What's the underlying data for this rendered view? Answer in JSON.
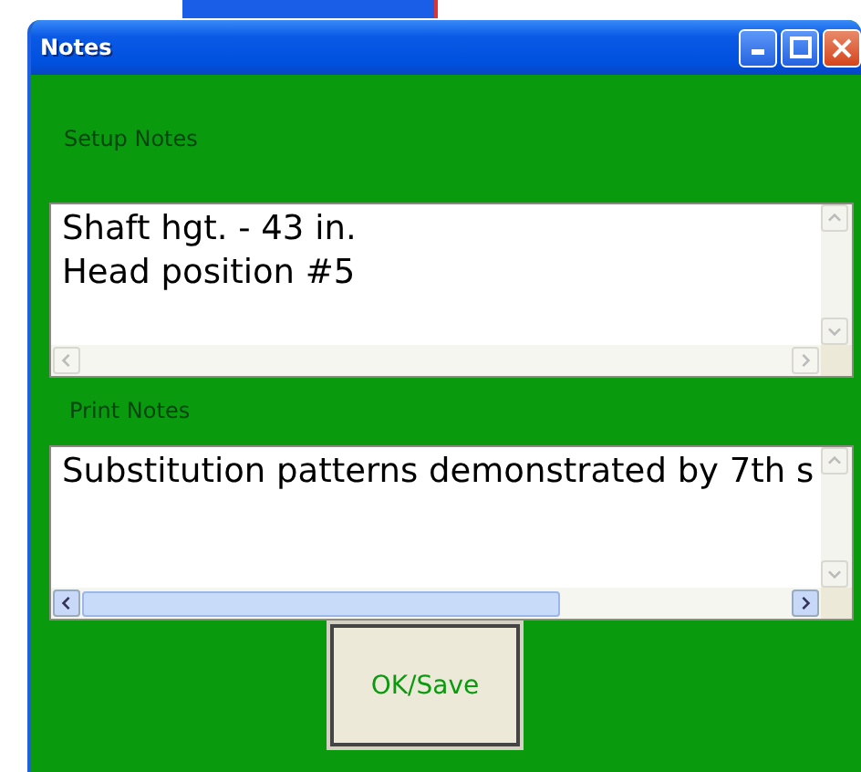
{
  "window": {
    "title": "Notes"
  },
  "fields": [
    {
      "label": "Setup Notes",
      "value": "Shaft hgt. - 43 in.\nHead position #5",
      "scrollable": false
    },
    {
      "label": "Print Notes",
      "value": "Substitution patterns demonstrated by 7th s",
      "scrollable": true
    }
  ],
  "buttons": [
    {
      "label": "OK/Save"
    }
  ]
}
